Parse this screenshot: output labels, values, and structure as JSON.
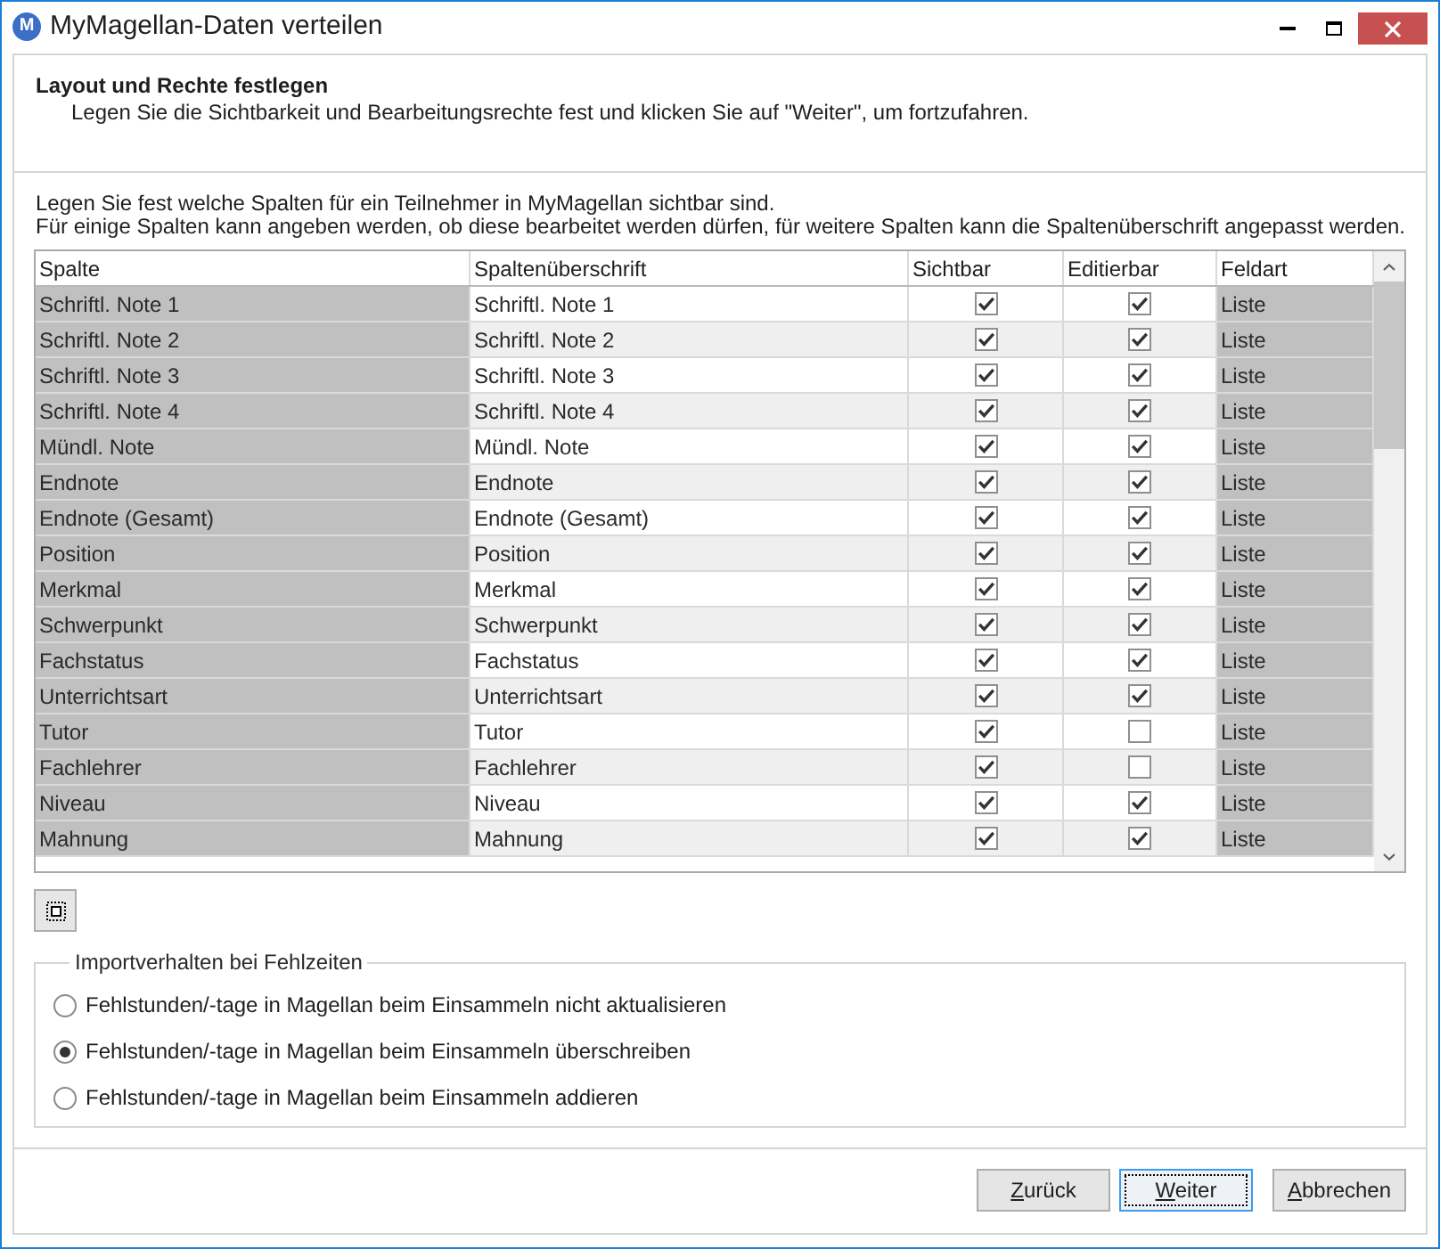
{
  "window": {
    "logo": "M",
    "title": "MyMagellan-Daten verteilen"
  },
  "header": {
    "title": "Layout und Rechte festlegen",
    "subtitle": "Legen Sie die Sichtbarkeit und Bearbeitungsrechte fest und klicken Sie auf \"Weiter\", um fortzufahren."
  },
  "instructions": [
    "Legen Sie fest welche Spalten für ein Teilnehmer in MyMagellan sichtbar sind.",
    "Für einige Spalten kann angeben werden, ob diese bearbeitet werden dürfen, für weitere Spalten kann die Spaltenüberschrift angepasst werden."
  ],
  "table": {
    "columns": [
      {
        "label": "Spalte",
        "read_only": true
      },
      {
        "label": "Spaltenüberschrift",
        "read_only": false
      },
      {
        "label": "Sichtbar",
        "read_only": false
      },
      {
        "label": "Editierbar",
        "read_only": false
      },
      {
        "label": "Feldart",
        "read_only": true
      }
    ],
    "rows": [
      {
        "spalte": "Schriftl. Note 1",
        "spaltenueberschrift": "Schriftl. Note 1",
        "sichtbar": true,
        "editierbar": true,
        "feldart": "Liste"
      },
      {
        "spalte": "Schriftl. Note 2",
        "spaltenueberschrift": "Schriftl. Note 2",
        "sichtbar": true,
        "editierbar": true,
        "feldart": "Liste"
      },
      {
        "spalte": "Schriftl. Note 3",
        "spaltenueberschrift": "Schriftl. Note 3",
        "sichtbar": true,
        "editierbar": true,
        "feldart": "Liste"
      },
      {
        "spalte": "Schriftl. Note 4",
        "spaltenueberschrift": "Schriftl. Note 4",
        "sichtbar": true,
        "editierbar": true,
        "feldart": "Liste"
      },
      {
        "spalte": "Mündl. Note",
        "spaltenueberschrift": "Mündl. Note",
        "sichtbar": true,
        "editierbar": true,
        "feldart": "Liste"
      },
      {
        "spalte": "Endnote",
        "spaltenueberschrift": "Endnote",
        "sichtbar": true,
        "editierbar": true,
        "feldart": "Liste"
      },
      {
        "spalte": "Endnote (Gesamt)",
        "spaltenueberschrift": "Endnote (Gesamt)",
        "sichtbar": true,
        "editierbar": true,
        "feldart": "Liste"
      },
      {
        "spalte": "Position",
        "spaltenueberschrift": "Position",
        "sichtbar": true,
        "editierbar": true,
        "feldart": "Liste"
      },
      {
        "spalte": "Merkmal",
        "spaltenueberschrift": "Merkmal",
        "sichtbar": true,
        "editierbar": true,
        "feldart": "Liste"
      },
      {
        "spalte": "Schwerpunkt",
        "spaltenueberschrift": "Schwerpunkt",
        "sichtbar": true,
        "editierbar": true,
        "feldart": "Liste"
      },
      {
        "spalte": "Fachstatus",
        "spaltenueberschrift": "Fachstatus",
        "sichtbar": true,
        "editierbar": true,
        "feldart": "Liste"
      },
      {
        "spalte": "Unterrichtsart",
        "spaltenueberschrift": "Unterrichtsart",
        "sichtbar": true,
        "editierbar": true,
        "feldart": "Liste"
      },
      {
        "spalte": "Tutor",
        "spaltenueberschrift": "Tutor",
        "sichtbar": true,
        "editierbar": false,
        "feldart": "Liste"
      },
      {
        "spalte": "Fachlehrer",
        "spaltenueberschrift": "Fachlehrer",
        "sichtbar": true,
        "editierbar": false,
        "feldart": "Liste"
      },
      {
        "spalte": "Niveau",
        "spaltenueberschrift": "Niveau",
        "sichtbar": true,
        "editierbar": true,
        "feldart": "Liste"
      },
      {
        "spalte": "Mahnung",
        "spaltenueberschrift": "Mahnung",
        "sichtbar": true,
        "editierbar": true,
        "feldart": "Liste"
      }
    ]
  },
  "absence_import": {
    "title": "Importverhalten bei Fehlzeiten",
    "options": [
      {
        "label": "Fehlstunden/-tage in Magellan beim Einsammeln nicht aktualisieren",
        "selected": false
      },
      {
        "label": "Fehlstunden/-tage in Magellan beim Einsammeln überschreiben",
        "selected": true
      },
      {
        "label": "Fehlstunden/-tage in Magellan beim Einsammeln addieren",
        "selected": false
      }
    ]
  },
  "buttons": [
    {
      "label": "Zurück",
      "focused": false
    },
    {
      "label": "Weiter",
      "focused": true
    },
    {
      "label": "Abbrechen",
      "focused": false
    }
  ]
}
